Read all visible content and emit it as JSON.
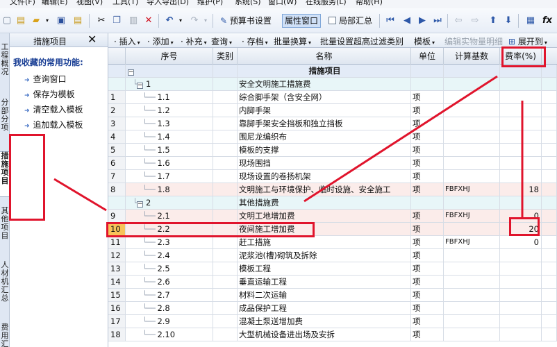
{
  "menu": [
    "文件(F)",
    "编辑(E)",
    "视图(V)",
    "工具(T)",
    "导入导出(D)",
    "维护(P)",
    "系统(S)",
    "窗口(W)",
    "在线服务(L)",
    "帮助(H)"
  ],
  "toolbar1": {
    "budget_settings": "预算书设置",
    "property_window": "属性窗口",
    "local_summary": "局部汇总"
  },
  "left_tabs": [
    "工程概况",
    "分部分项",
    "措施项目",
    "其他项目",
    "人材机汇总",
    "费用汇总"
  ],
  "side_panel": {
    "title": "措施项目",
    "close_label": "✕",
    "favorites_title": "我收藏的常用功能:",
    "items": [
      "查询窗口",
      "保存为模板",
      "清空载入模板",
      "追加载入模板"
    ]
  },
  "toolbar2": {
    "insert": "插入",
    "add": "添加",
    "supplement": "补充",
    "query": "查询",
    "save": "存档",
    "batch_convert": "批量换算",
    "batch_set": "批量设置超高过滤类别",
    "template": "模板",
    "edit_detail": "编辑实物量明细",
    "expand_to": "展开到"
  },
  "columns": {
    "seq": "序号",
    "category": "类别",
    "name": "名称",
    "unit": "单位",
    "base": "计算基数",
    "rate": "费率(%)"
  },
  "rows": [
    {
      "num": "",
      "seq": "",
      "name": "措施项目",
      "unit": "",
      "base": "",
      "rate": ""
    },
    {
      "num": "",
      "seq": "1",
      "name": "安全文明施工措施费",
      "unit": "",
      "base": "",
      "rate": ""
    },
    {
      "num": "1",
      "seq": "1.1",
      "name": "综合脚手架（含安全网）",
      "unit": "项",
      "base": "",
      "rate": ""
    },
    {
      "num": "2",
      "seq": "1.2",
      "name": "内脚手架",
      "unit": "项",
      "base": "",
      "rate": ""
    },
    {
      "num": "3",
      "seq": "1.3",
      "name": "靠脚手架安全挡板和独立挡板",
      "unit": "项",
      "base": "",
      "rate": ""
    },
    {
      "num": "4",
      "seq": "1.4",
      "name": "围尼龙编织布",
      "unit": "项",
      "base": "",
      "rate": ""
    },
    {
      "num": "5",
      "seq": "1.5",
      "name": "模板的支撑",
      "unit": "项",
      "base": "",
      "rate": ""
    },
    {
      "num": "6",
      "seq": "1.6",
      "name": "现场围挡",
      "unit": "项",
      "base": "",
      "rate": ""
    },
    {
      "num": "7",
      "seq": "1.7",
      "name": "现场设置的卷扬机架",
      "unit": "项",
      "base": "",
      "rate": ""
    },
    {
      "num": "8",
      "seq": "1.8",
      "name": "文明施工与环境保护、临时设施、安全施工",
      "unit": "项",
      "base": "FBFXHJ",
      "rate": "18"
    },
    {
      "num": "",
      "seq": "2",
      "name": "其他措施费",
      "unit": "",
      "base": "",
      "rate": ""
    },
    {
      "num": "9",
      "seq": "2.1",
      "name": "文明工地增加费",
      "unit": "项",
      "base": "FBFXHJ",
      "rate": "0"
    },
    {
      "num": "10",
      "seq": "2.2",
      "name": "夜间施工增加费",
      "unit": "项",
      "base": "",
      "rate": "20"
    },
    {
      "num": "11",
      "seq": "2.3",
      "name": "赶工措施",
      "unit": "项",
      "base": "FBFXHJ",
      "rate": "0"
    },
    {
      "num": "12",
      "seq": "2.4",
      "name": "泥浆池(槽)砌筑及拆除",
      "unit": "项",
      "base": "",
      "rate": ""
    },
    {
      "num": "13",
      "seq": "2.5",
      "name": "模板工程",
      "unit": "项",
      "base": "",
      "rate": ""
    },
    {
      "num": "14",
      "seq": "2.6",
      "name": "垂直运输工程",
      "unit": "项",
      "base": "",
      "rate": ""
    },
    {
      "num": "15",
      "seq": "2.7",
      "name": "材料二次运输",
      "unit": "项",
      "base": "",
      "rate": ""
    },
    {
      "num": "16",
      "seq": "2.8",
      "name": "成品保护工程",
      "unit": "项",
      "base": "",
      "rate": ""
    },
    {
      "num": "17",
      "seq": "2.9",
      "name": "混凝土泵送增加费",
      "unit": "项",
      "base": "",
      "rate": ""
    },
    {
      "num": "18",
      "seq": "2.10",
      "name": "大型机械设备进出场及安拆",
      "unit": "项",
      "base": "",
      "rate": ""
    }
  ],
  "colors": {
    "annotation": "#e0142c",
    "current_row_marker": "#f7c35a"
  }
}
